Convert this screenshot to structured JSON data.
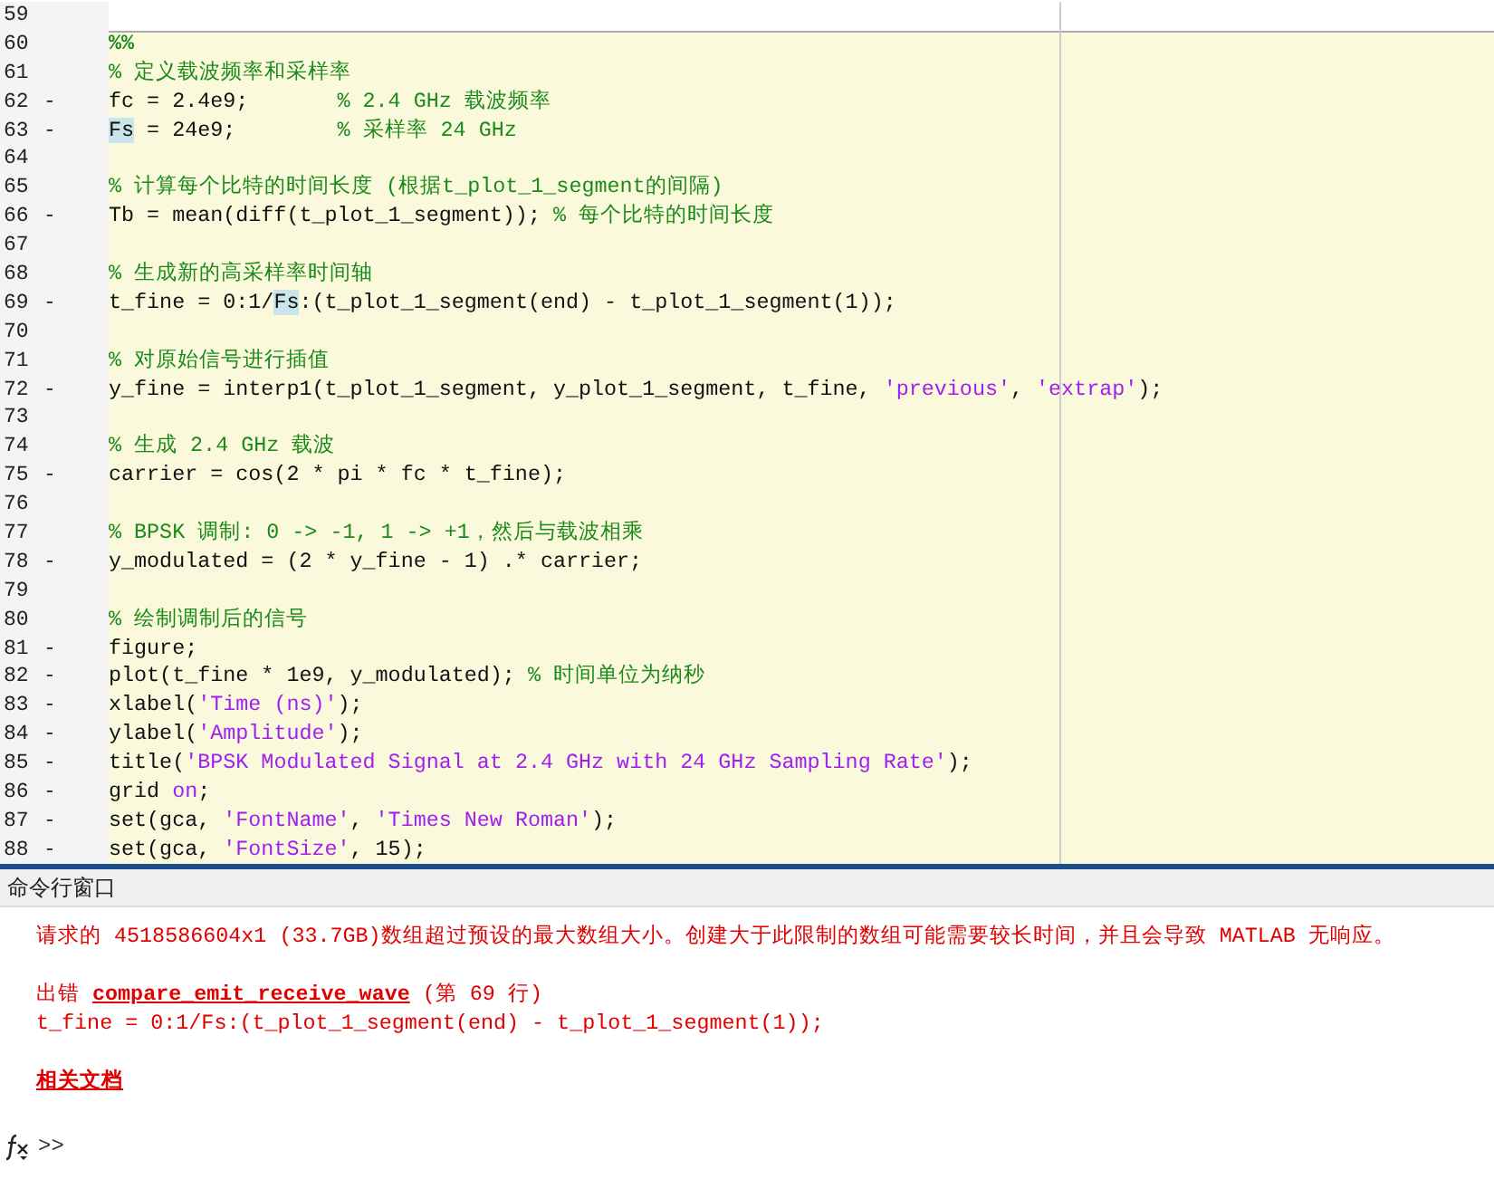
{
  "editor": {
    "lines": [
      {
        "number": "59"
      }
    ],
    "cell": {
      "lines": [
        {
          "number": "60",
          "tokens": [
            {
              "kind": "cell",
              "text": "%%"
            }
          ]
        },
        {
          "number": "61",
          "tokens": [
            {
              "kind": "comment",
              "text": "% 定义载波频率和采样率"
            }
          ]
        },
        {
          "number": "62",
          "marker": "-",
          "tokens": [
            {
              "kind": "code",
              "text": "fc = 2.4e9;       "
            },
            {
              "kind": "comment",
              "text": "% 2.4 GHz 载波频率"
            }
          ]
        },
        {
          "number": "63",
          "marker": "-",
          "tokens": [
            {
              "kind": "highlight",
              "text": "Fs"
            },
            {
              "kind": "code",
              "text": " = 24e9;        "
            },
            {
              "kind": "comment",
              "text": "% 采样率 24 GHz"
            }
          ]
        },
        {
          "number": "64"
        },
        {
          "number": "65",
          "tokens": [
            {
              "kind": "comment",
              "text": "% 计算每个比特的时间长度 (根据t_plot_1_segment的间隔)"
            }
          ]
        },
        {
          "number": "66",
          "marker": "-",
          "tokens": [
            {
              "kind": "code",
              "text": "Tb = mean(diff(t_plot_1_segment)); "
            },
            {
              "kind": "comment",
              "text": "% 每个比特的时间长度"
            }
          ]
        },
        {
          "number": "67"
        },
        {
          "number": "68",
          "tokens": [
            {
              "kind": "comment",
              "text": "% 生成新的高采样率时间轴"
            }
          ]
        },
        {
          "number": "69",
          "marker": "-",
          "tokens": [
            {
              "kind": "code",
              "text": "t_fine = 0:1/"
            },
            {
              "kind": "highlight",
              "text": "Fs"
            },
            {
              "kind": "code",
              "text": ":(t_plot_1_segment(end) - t_plot_1_segment(1));"
            }
          ]
        },
        {
          "number": "70"
        },
        {
          "number": "71",
          "tokens": [
            {
              "kind": "comment",
              "text": "% 对原始信号进行插值"
            }
          ]
        },
        {
          "number": "72",
          "marker": "-",
          "tokens": [
            {
              "kind": "code",
              "text": "y_fine = interp1(t_plot_1_segment, y_plot_1_segment, t_fine, "
            },
            {
              "kind": "string",
              "text": "'previous'"
            },
            {
              "kind": "code",
              "text": ", "
            },
            {
              "kind": "string",
              "text": "'extrap'"
            },
            {
              "kind": "code",
              "text": ");"
            }
          ]
        },
        {
          "number": "73"
        },
        {
          "number": "74",
          "tokens": [
            {
              "kind": "comment",
              "text": "% 生成 2.4 GHz 载波"
            }
          ]
        },
        {
          "number": "75",
          "marker": "-",
          "tokens": [
            {
              "kind": "code",
              "text": "carrier = cos(2 * pi * fc * t_fine);"
            }
          ]
        },
        {
          "number": "76"
        },
        {
          "number": "77",
          "tokens": [
            {
              "kind": "comment",
              "text": "% BPSK 调制: 0 -> -1, 1 -> +1，然后与载波相乘"
            }
          ]
        },
        {
          "number": "78",
          "marker": "-",
          "tokens": [
            {
              "kind": "code",
              "text": "y_modulated = (2 * y_fine - 1) .* carrier;"
            }
          ]
        },
        {
          "number": "79"
        },
        {
          "number": "80",
          "tokens": [
            {
              "kind": "comment",
              "text": "% 绘制调制后的信号"
            }
          ]
        },
        {
          "number": "81",
          "marker": "-",
          "tokens": [
            {
              "kind": "code",
              "text": "figure;"
            }
          ]
        },
        {
          "number": "82",
          "marker": "-",
          "tokens": [
            {
              "kind": "code",
              "text": "plot(t_fine * 1e9, y_modulated); "
            },
            {
              "kind": "comment",
              "text": "% 时间单位为纳秒"
            }
          ]
        },
        {
          "number": "83",
          "marker": "-",
          "tokens": [
            {
              "kind": "code",
              "text": "xlabel("
            },
            {
              "kind": "string",
              "text": "'Time (ns)'"
            },
            {
              "kind": "code",
              "text": ");"
            }
          ]
        },
        {
          "number": "84",
          "marker": "-",
          "tokens": [
            {
              "kind": "code",
              "text": "ylabel("
            },
            {
              "kind": "string",
              "text": "'Amplitude'"
            },
            {
              "kind": "code",
              "text": ");"
            }
          ]
        },
        {
          "number": "85",
          "marker": "-",
          "tokens": [
            {
              "kind": "code",
              "text": "title("
            },
            {
              "kind": "string",
              "text": "'BPSK Modulated Signal at 2.4 GHz with 24 GHz Sampling Rate'"
            },
            {
              "kind": "code",
              "text": ");"
            }
          ]
        },
        {
          "number": "86",
          "marker": "-",
          "tokens": [
            {
              "kind": "code",
              "text": "grid "
            },
            {
              "kind": "string",
              "text": "on"
            },
            {
              "kind": "code",
              "text": ";"
            }
          ]
        },
        {
          "number": "87",
          "marker": "-",
          "tokens": [
            {
              "kind": "code",
              "text": "set(gca, "
            },
            {
              "kind": "string",
              "text": "'FontName'"
            },
            {
              "kind": "code",
              "text": ", "
            },
            {
              "kind": "string",
              "text": "'Times New Roman'"
            },
            {
              "kind": "code",
              "text": ");"
            }
          ]
        },
        {
          "number": "88",
          "marker": "-",
          "tokens": [
            {
              "kind": "code",
              "text": "set(gca, "
            },
            {
              "kind": "string",
              "text": "'FontSize'"
            },
            {
              "kind": "code",
              "text": ", 15);"
            }
          ]
        }
      ]
    }
  },
  "command_window": {
    "title": "命令行窗口",
    "error_message": "请求的 4518586604x1 (33.7GB)数组超过预设的最大数组大小。创建大于此限制的数组可能需要较长时间，并且会导致 MATLAB 无响应。",
    "error_location": {
      "prefix": "出错",
      "function_link": "compare_emit_receive_wave",
      "suffix": "(第 69 行)"
    },
    "error_code": "t_fine = 0:1/Fs:(t_plot_1_segment(end) - t_plot_1_segment(1));",
    "docs_link": "相关文档",
    "prompt": ">>"
  }
}
